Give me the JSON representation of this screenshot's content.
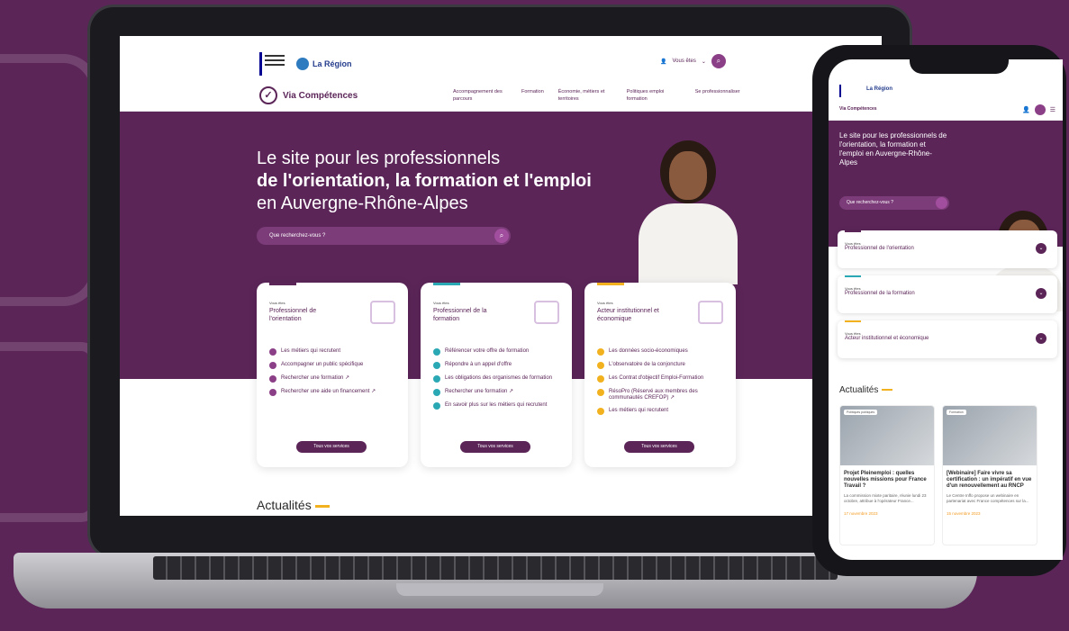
{
  "site": {
    "region_name": "La Région",
    "brand": "Via Compétences",
    "user_menu": "Vous êtes",
    "nav": [
      "Accompagnement des parcours",
      "Formation",
      "Économie, métiers et territoires",
      "Politiques emploi formation",
      "Se professionnaliser"
    ]
  },
  "hero": {
    "line1": "Le site pour les professionnels",
    "line2": "de l'orientation, la formation et l'emploi",
    "line3": "en Auvergne-Rhône-Alpes",
    "search_placeholder": "Que recherchez-vous ?"
  },
  "cards": [
    {
      "kicker": "Vous êtes",
      "title": "Professionnel de l'orientation",
      "items": [
        "Les métiers qui recrutent",
        "Accompagner un public spécifique",
        "Rechercher une formation ↗",
        "Rechercher une aide un financement ↗"
      ],
      "button": "Tous vos services"
    },
    {
      "kicker": "Vous êtes",
      "title": "Professionnel de la formation",
      "items": [
        "Référencer votre offre de formation",
        "Répondre à un appel d'offre",
        "Les obligations des organismes de formation",
        "Rechercher une formation ↗",
        "En savoir plus sur les métiers qui recrutent"
      ],
      "button": "Tous vos services"
    },
    {
      "kicker": "Vous êtes",
      "title": "Acteur institutionnel et économique",
      "items": [
        "Les données socio-économiques",
        "L'observatoire de la conjoncture",
        "Les Contrat d'objectif Emploi-Formation",
        "RésoPro (Réservé aux membres des communautés CREFOP) ↗",
        "Les métiers qui recrutent"
      ],
      "button": "Tous vos services"
    }
  ],
  "news": {
    "title": "Actualités",
    "items": [
      {
        "tag": "Politiques publiques",
        "headline": "Projet Pleinemploi : quelles nouvelles missions pour France Travail ?",
        "summary": "La commission mixte paritaire, réunie lundi 23 octobre, attribue à l'opérateur France...",
        "date": "17 novembre 2023"
      },
      {
        "tag": "Formation",
        "headline": "[Webinaire] Faire vivre sa certification : un impératif en vue d'un renouvellement au RNCP",
        "summary": "Le Centre Inffo propose un webinaire en partenariat avec France compétences sur la...",
        "date": "15 novembre 2023"
      }
    ]
  },
  "phone": {
    "hero": "Le site pour les professionnels de l'orientation, la formation et l'emploi en Auvergne-Rhône-Alpes",
    "cards": [
      {
        "kicker": "Vous êtes",
        "title": "Professionnel de l'orientation"
      },
      {
        "kicker": "Vous êtes",
        "title": "Professionnel de la formation"
      },
      {
        "kicker": "Vous êtes",
        "title": "Acteur institutionnel et économique"
      }
    ]
  }
}
